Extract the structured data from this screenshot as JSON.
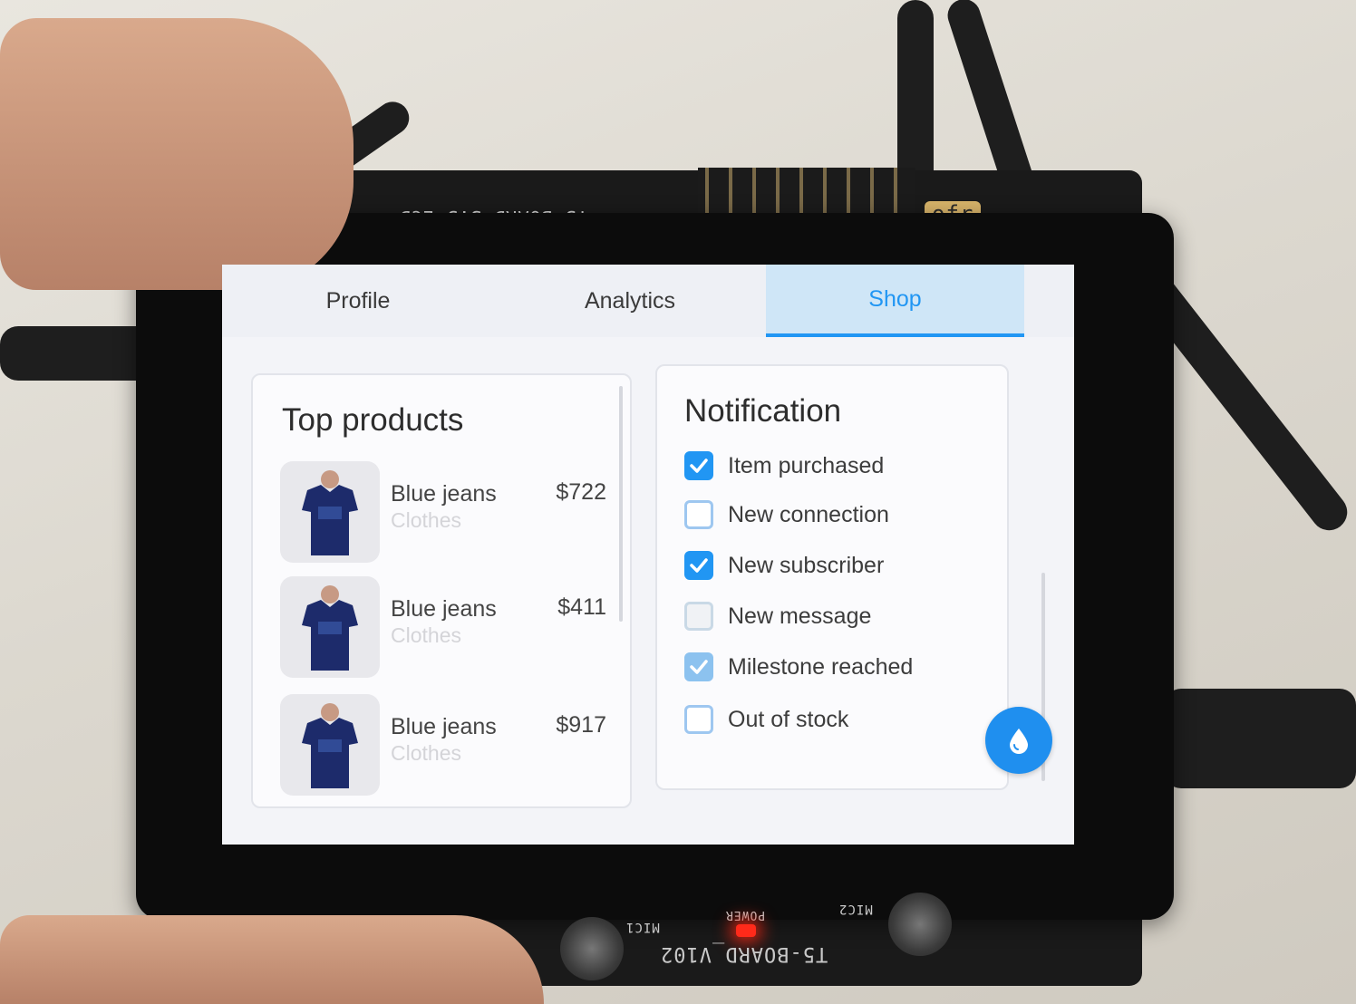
{
  "tabs": [
    {
      "label": "Profile",
      "active": false
    },
    {
      "label": "Analytics",
      "active": false
    },
    {
      "label": "Shop",
      "active": true
    }
  ],
  "top_products": {
    "title": "Top products",
    "items": [
      {
        "name": "Blue jeans",
        "category": "Clothes",
        "price": "$722"
      },
      {
        "name": "Blue jeans",
        "category": "Clothes",
        "price": "$411"
      },
      {
        "name": "Blue jeans",
        "category": "Clothes",
        "price": "$917"
      }
    ]
  },
  "notification": {
    "title": "Notification",
    "items": [
      {
        "label": "Item purchased",
        "checked": true
      },
      {
        "label": "New connection",
        "checked": false
      },
      {
        "label": "New subscriber",
        "checked": true
      },
      {
        "label": "New message",
        "checked": false
      },
      {
        "label": "Milestone reached",
        "checked": true
      },
      {
        "label": "Out of stock",
        "checked": false
      }
    ]
  },
  "fab": {
    "icon": "water-drop-icon"
  },
  "board": {
    "top_label": "T5-BOARD-3.5 LCD",
    "bottom_label": "T5-BOARD_V102",
    "mic1_label": "MIC1",
    "mic2_label": "MIC2",
    "power_label": "POWER",
    "brand_label": "ofr"
  },
  "colors": {
    "accent": "#2196f3",
    "tab_active_bg": "#cfe6f7",
    "led": "#ff2a1a"
  }
}
